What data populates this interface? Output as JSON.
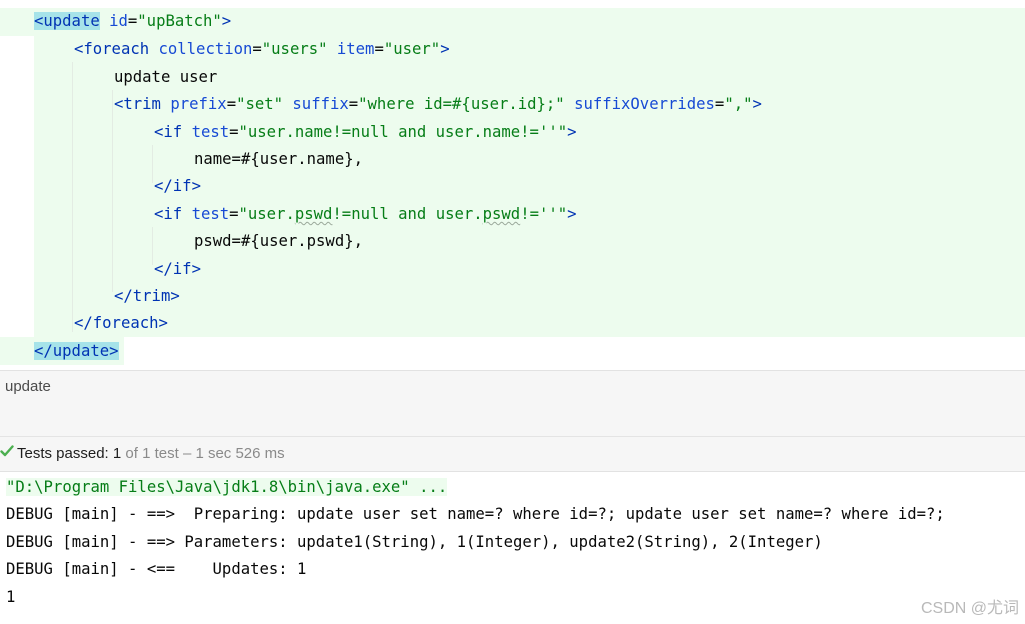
{
  "editor": {
    "l1": {
      "tag_open": "update",
      "attr": "id",
      "val": "\"upBatch\""
    },
    "l2": {
      "tag": "foreach",
      "a1": "collection",
      "v1": "\"users\"",
      "a2": "item",
      "v2": "\"user\""
    },
    "l3": {
      "text": "update user"
    },
    "l4": {
      "tag": "trim",
      "a1": "prefix",
      "v1": "\"set\"",
      "a2": "suffix",
      "v2": "\"where id=#{user.id};\"",
      "a3": "suffixOverrides",
      "v3": "\",\""
    },
    "l5": {
      "tag": "if",
      "a": "test",
      "v_pre": "\"user.name!=null and user.name!=",
      "v_post": "''\""
    },
    "l6": {
      "text": "name=#{user.name},"
    },
    "l7": {
      "tag": "if"
    },
    "l8": {
      "tag": "if",
      "a": "test",
      "v_a": "\"user.",
      "v_b": "pswd",
      "v_c": "!=null and user.",
      "v_d": "pswd",
      "v_e": "!=''\""
    },
    "l9": {
      "text": "pswd=#{user.pswd},"
    },
    "l10": {
      "tag": "if"
    },
    "l11": {
      "tag": "trim"
    },
    "l12": {
      "tag": "foreach"
    },
    "l13": {
      "tag": "update"
    }
  },
  "breadcrumb": {
    "label": "update"
  },
  "test_status": {
    "passed_label": "Tests passed:",
    "passed_count": "1",
    "detail": "of 1 test – 1 sec 526 ms"
  },
  "console": {
    "lines": [
      "\"D:\\Program Files\\Java\\jdk1.8\\bin\\java.exe\" ...",
      "DEBUG [main] - ==>  Preparing: update user set name=? where id=?; update user set name=? where id=?;",
      "DEBUG [main] - ==> Parameters: update1(String), 1(Integer), update2(String), 2(Integer)",
      "DEBUG [main] - <==    Updates: 1",
      "1"
    ]
  },
  "watermark": "CSDN @尤词",
  "colors": {
    "tag": "#0033b3",
    "attr_name": "#174ad4",
    "attr_value": "#067d17",
    "band": "#edfcee",
    "match_highlight": "#a6e3e9",
    "check": "#4caf50"
  }
}
